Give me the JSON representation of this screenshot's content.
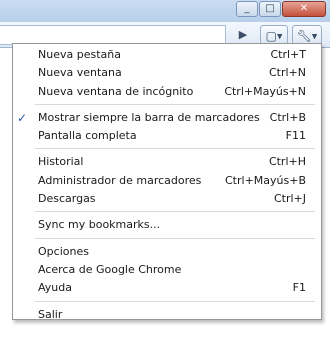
{
  "window": {
    "minimize_glyph": "_",
    "maximize_glyph": "□",
    "close_glyph": "✕"
  },
  "toolbar": {
    "go_icon": "play-arrow-icon",
    "page_icon": "page-menu-icon",
    "tools_icon": "wrench-icon"
  },
  "menu": {
    "groups": [
      [
        {
          "label": "Nueva pestaña",
          "shortcut": "Ctrl+T"
        },
        {
          "label": "Nueva ventana",
          "shortcut": "Ctrl+N"
        },
        {
          "label": "Nueva ventana de incógnito",
          "shortcut": "Ctrl+Mayús+N"
        }
      ],
      [
        {
          "label": "Mostrar siempre la barra de marcadores",
          "shortcut": "Ctrl+B",
          "checked": true
        },
        {
          "label": "Pantalla completa",
          "shortcut": "F11"
        }
      ],
      [
        {
          "label": "Historial",
          "shortcut": "Ctrl+H"
        },
        {
          "label": "Administrador de marcadores",
          "shortcut": "Ctrl+Mayús+B"
        },
        {
          "label": "Descargas",
          "shortcut": "Ctrl+J"
        }
      ],
      [
        {
          "label": "Sync my bookmarks...",
          "shortcut": ""
        }
      ],
      [
        {
          "label": "Opciones",
          "shortcut": ""
        },
        {
          "label": "Acerca de Google Chrome",
          "shortcut": ""
        },
        {
          "label": "Ayuda",
          "shortcut": "F1"
        }
      ],
      [
        {
          "label": "Salir",
          "shortcut": ""
        }
      ]
    ],
    "check_glyph": "✓"
  }
}
